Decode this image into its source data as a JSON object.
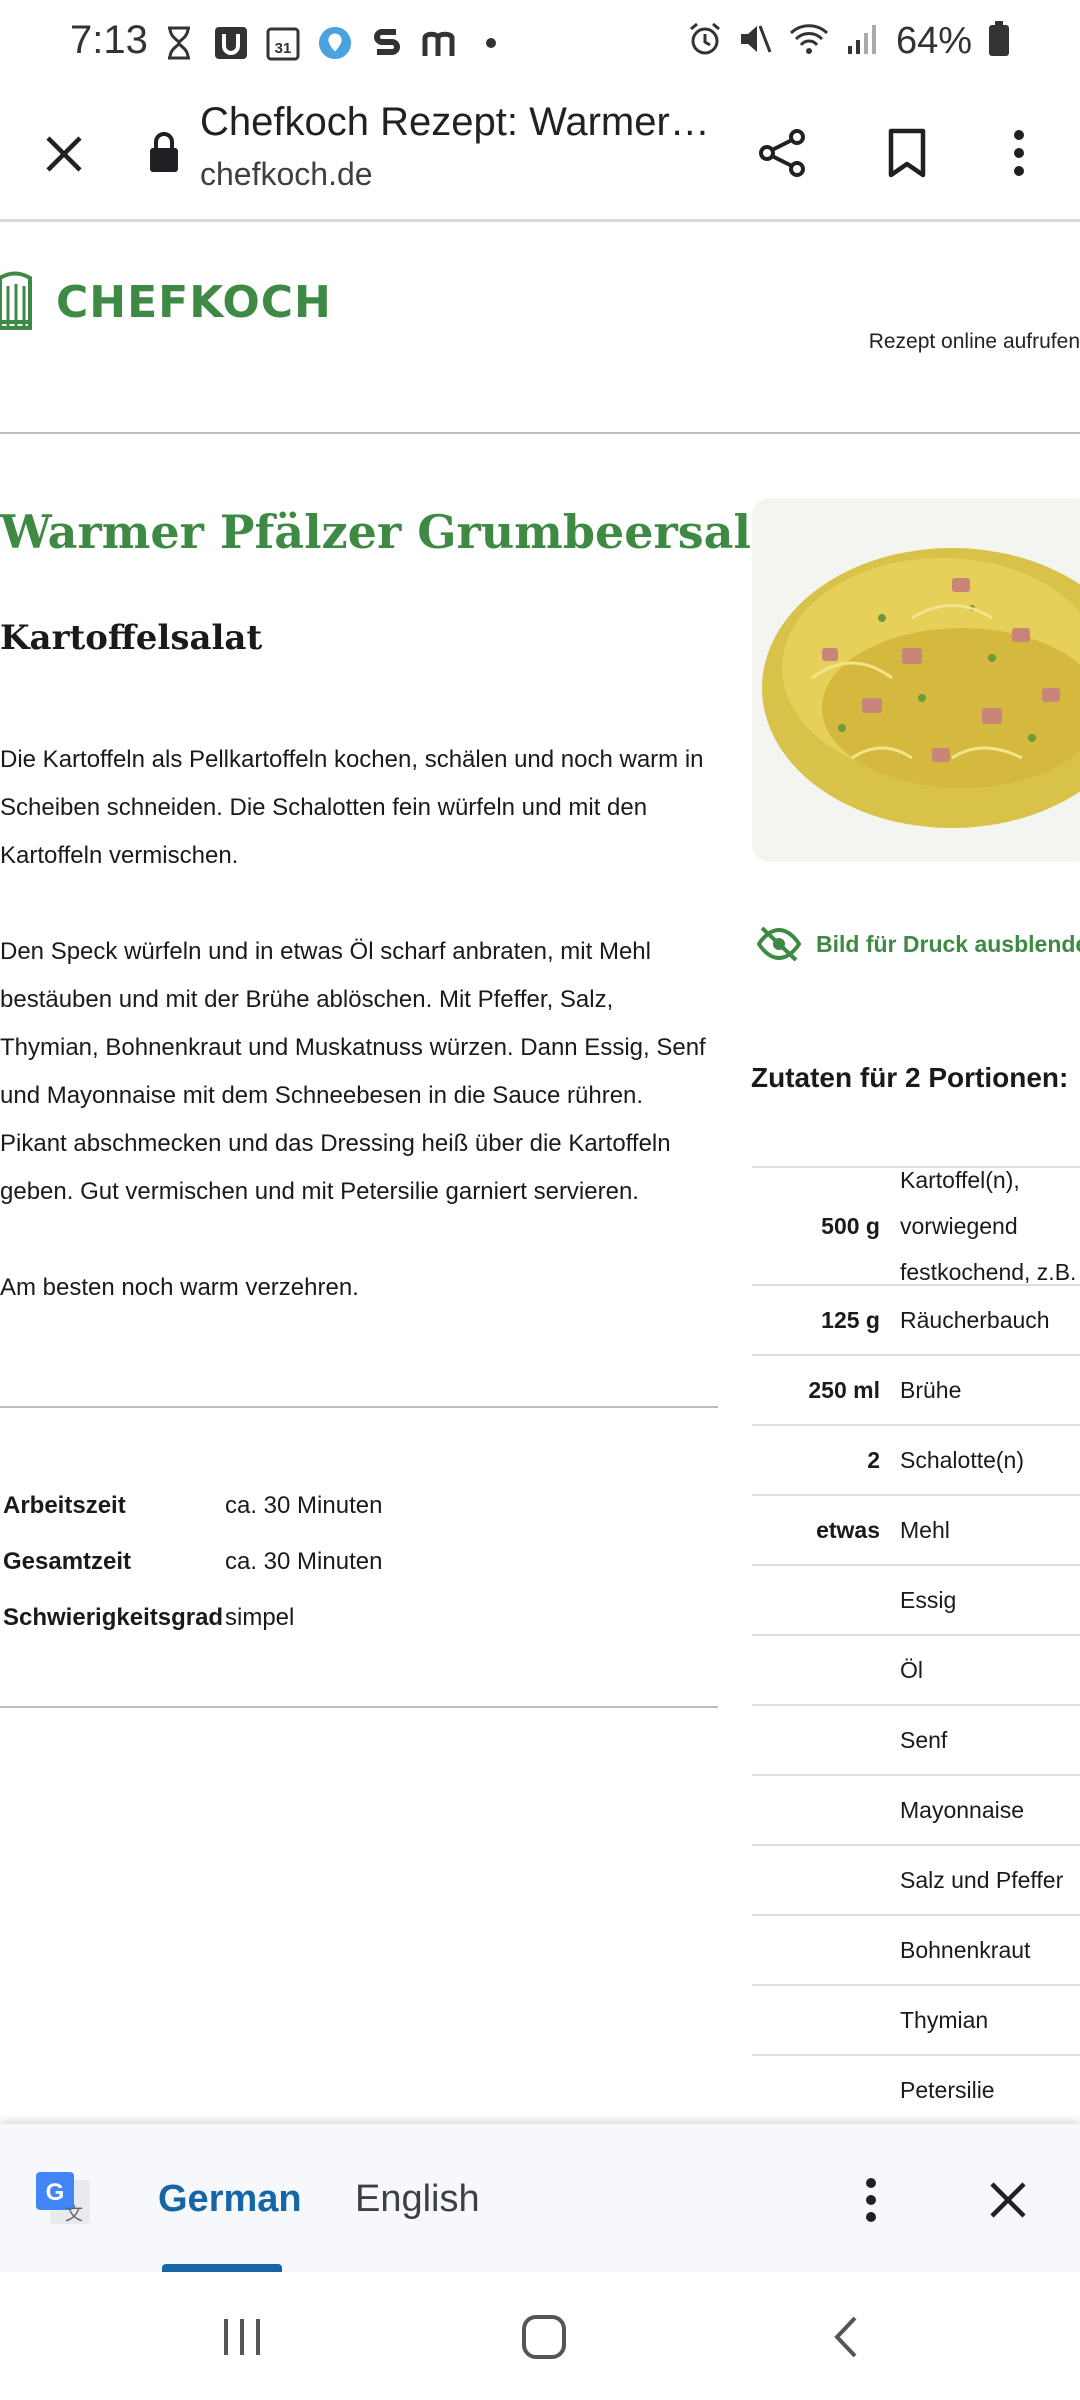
{
  "status_bar": {
    "time": "7:13",
    "battery": "64%",
    "icons_left": [
      "hourglass-icon",
      "u-app-icon",
      "calendar-31-icon",
      "location-icon",
      "s-app-icon",
      "m-app-icon",
      "dot-icon"
    ],
    "icons_right": [
      "alarm-icon",
      "mute-icon",
      "wifi-icon",
      "signal-icon",
      "battery-icon"
    ],
    "calendar_day": "31"
  },
  "tab_bar": {
    "title": "Chefkoch Rezept: Warmer Pfälzer Grumbeersalat",
    "url": "chefkoch.de"
  },
  "site": {
    "logo_text": "CHEFKOCH",
    "online_link": "Rezept online aufrufen"
  },
  "recipe": {
    "title": "Warmer Pfälzer Grumbeersalat",
    "subtitle": "Kartoffelsalat",
    "instructions": [
      "Die Kartoffeln als Pellkartoffeln kochen, schälen und noch warm in Scheiben schneiden. Die Schalotten fein würfeln und mit den Kartoffeln vermischen.",
      "Den Speck würfeln und in etwas Öl scharf anbraten, mit Mehl bestäuben und mit der Brühe ablöschen. Mit Pfeffer, Salz, Thymian, Bohnenkraut und Muskatnuss würzen. Dann Essig, Senf und Mayonnaise mit dem Schneebesen in die Sauce rühren. Pikant abschmecken und das Dressing heiß über die Kartoffeln geben. Gut vermischen und mit Petersilie garniert servieren.",
      "Am besten noch warm verzehren."
    ],
    "meta": [
      {
        "key": "Arbeitszeit",
        "value": "ca. 30 Minuten"
      },
      {
        "key": "Gesamtzeit",
        "value": "ca. 30 Minuten"
      },
      {
        "key": "Schwierigkeitsgrad",
        "value": "simpel"
      }
    ],
    "hide_image_label": "Bild für Druck ausblenden",
    "ingredients_heading": "Zutaten für 2 Portionen:",
    "ingredients": [
      {
        "amount": "500 g",
        "name": "Kartoffel(n), vorwiegend festkochend, z.B."
      },
      {
        "amount": "125 g",
        "name": "Räucherbauch"
      },
      {
        "amount": "250 ml",
        "name": "Brühe"
      },
      {
        "amount": "2",
        "name": "Schalotte(n)"
      },
      {
        "amount": "etwas",
        "name": "Mehl"
      },
      {
        "amount": "",
        "name": "Essig"
      },
      {
        "amount": "",
        "name": "Öl"
      },
      {
        "amount": "",
        "name": "Senf"
      },
      {
        "amount": "",
        "name": "Mayonnaise"
      },
      {
        "amount": "",
        "name": "Salz und Pfeffer"
      },
      {
        "amount": "",
        "name": "Bohnenkraut"
      },
      {
        "amount": "",
        "name": "Thymian"
      },
      {
        "amount": "",
        "name": "Petersilie"
      }
    ]
  },
  "translate_bar": {
    "source_language": "German",
    "target_language": "English"
  },
  "colors": {
    "brand_green": "#3e8a44",
    "translate_blue": "#1565a7"
  }
}
